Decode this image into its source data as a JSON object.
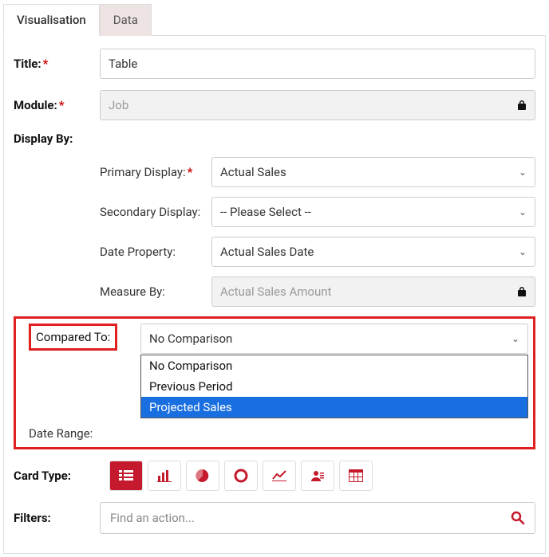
{
  "tabs": {
    "visualisation": "Visualisation",
    "data": "Data"
  },
  "labels": {
    "title": "Title:",
    "module": "Module:",
    "displayBy": "Display By:",
    "primary": "Primary Display:",
    "secondary": "Secondary Display:",
    "dateProp": "Date Property:",
    "measureBy": "Measure By:",
    "comparedTo": "Compared To:",
    "dateRange": "Date Range:",
    "cardType": "Card Type:",
    "filters": "Filters:"
  },
  "values": {
    "title": "Table",
    "module": "Job",
    "primary": "Actual Sales",
    "secondary": "-- Please Select --",
    "dateProp": "Actual Sales Date",
    "measureBy": "Actual Sales Amount",
    "comparedTo": "No Comparison"
  },
  "comparedOptions": [
    "No Comparison",
    "Previous Period",
    "Projected Sales"
  ],
  "filtersPlaceholder": "Find an action...",
  "asterisk": "*"
}
